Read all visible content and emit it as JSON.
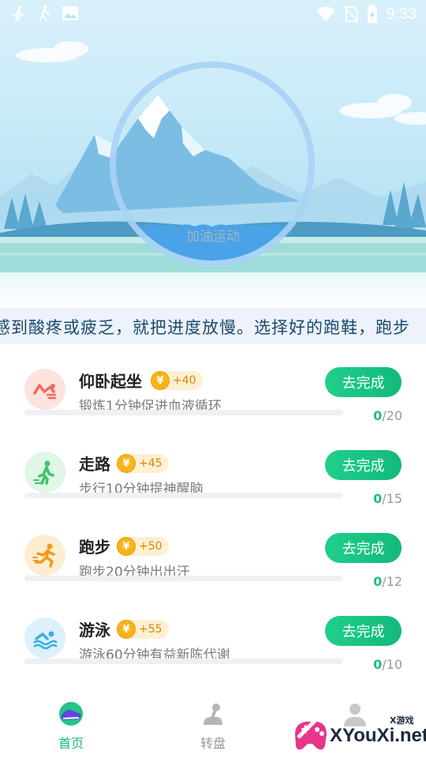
{
  "status_bar": {
    "time": "9:33",
    "left_icons": [
      "walk-icon",
      "walk-icon",
      "image-icon"
    ],
    "right_icons": [
      "wifi-icon",
      "no-sim-icon",
      "battery-icon"
    ]
  },
  "hero": {
    "ring_label": "加油运动",
    "progress": 0.2
  },
  "marquee": {
    "text": "感到酸疼或疲乏，就把进度放慢。选择好的跑鞋，跑步"
  },
  "tasks": [
    {
      "title": "仰卧起坐",
      "reward": "+40",
      "coin_symbol": "¥",
      "desc": "锻炼1分钟促进血液循环",
      "button": "去完成",
      "done": "0",
      "total": "/20",
      "icon": "situp-icon",
      "icon_bg": "#fde3dd",
      "icon_color": "#f06b5b"
    },
    {
      "title": "走路",
      "reward": "+45",
      "coin_symbol": "¥",
      "desc": "步行10分钟提神醒脑",
      "button": "去完成",
      "done": "0",
      "total": "/15",
      "icon": "walk-icon",
      "icon_bg": "#e0f6e7",
      "icon_color": "#3cc56b"
    },
    {
      "title": "跑步",
      "reward": "+50",
      "coin_symbol": "¥",
      "desc": "跑步20分钟出出汗",
      "button": "去完成",
      "done": "0",
      "total": "/12",
      "icon": "run-icon",
      "icon_bg": "#fdeed2",
      "icon_color": "#f29a1a"
    },
    {
      "title": "游泳",
      "reward": "+55",
      "coin_symbol": "¥",
      "desc": "游泳60分钟有益新陈代谢",
      "button": "去完成",
      "done": "0",
      "total": "/10",
      "icon": "swim-icon",
      "icon_bg": "#dcf1fb",
      "icon_color": "#3aaee2"
    }
  ],
  "bottom_nav": [
    {
      "label": "首页",
      "icon": "home-shoe-icon",
      "active": true
    },
    {
      "label": "转盘",
      "icon": "joystick-icon",
      "active": false
    },
    {
      "label": "",
      "icon": "profile-icon",
      "active": false
    }
  ],
  "watermark": {
    "small": "X游戏",
    "text": "XYouXi.net"
  },
  "colors": {
    "accent": "#13b97b",
    "coin": "#f6b41c",
    "marquee_text": "#1a4a6e"
  }
}
